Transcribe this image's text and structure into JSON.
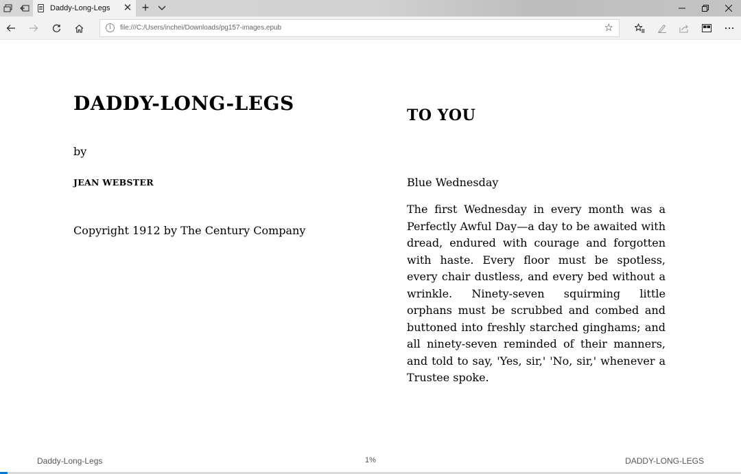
{
  "browser": {
    "tab": {
      "title": "Daddy-Long-Legs"
    },
    "new_tab_glyph": "+",
    "address": {
      "url": "file:///C:/Users/inchei/Downloads/pg157-images.epub"
    },
    "icons": [
      "set-aside-tabs-icon",
      "restore-tabs-icon",
      "page-icon",
      "close-icon",
      "plus-icon",
      "chevron-down-icon",
      "minimize-icon",
      "maximize-icon",
      "back-icon",
      "forward-icon",
      "refresh-icon",
      "home-icon",
      "info-icon",
      "star-icon",
      "favorites-icon",
      "pen-icon",
      "share-icon",
      "reading-view-icon",
      "more-icon"
    ]
  },
  "book": {
    "title": "DADDY-LONG-LEGS",
    "by": "by",
    "author": "JEAN WEBSTER",
    "copyright": "Copyright 1912 by The Century Company",
    "dedication": "TO YOU",
    "chapter_title": "Blue Wednesday",
    "paragraph": "The first Wednesday in every month was a Perfectly Awful Day—a day to be awaited with dread, endured with courage and forgotten with haste. Every floor must be spotless, every chair dustless, and every bed without a wrinkle. Ninety-seven squirming little orphans must be scrubbed and combed and buttoned into freshly starched ginghams; and all ninety-seven reminded of their manners, and told to say, 'Yes, sir,' 'No, sir,' whenever a Trustee spoke."
  },
  "footer": {
    "left": "Daddy-Long-Legs",
    "progress_label": "1%",
    "progress_fraction": 0.01,
    "right": "DADDY-LONG-LEGS"
  },
  "colors": {
    "accent": "#0078d7",
    "tab_active": "#f2f2f2",
    "tabstrip": "#d2d2d2"
  }
}
